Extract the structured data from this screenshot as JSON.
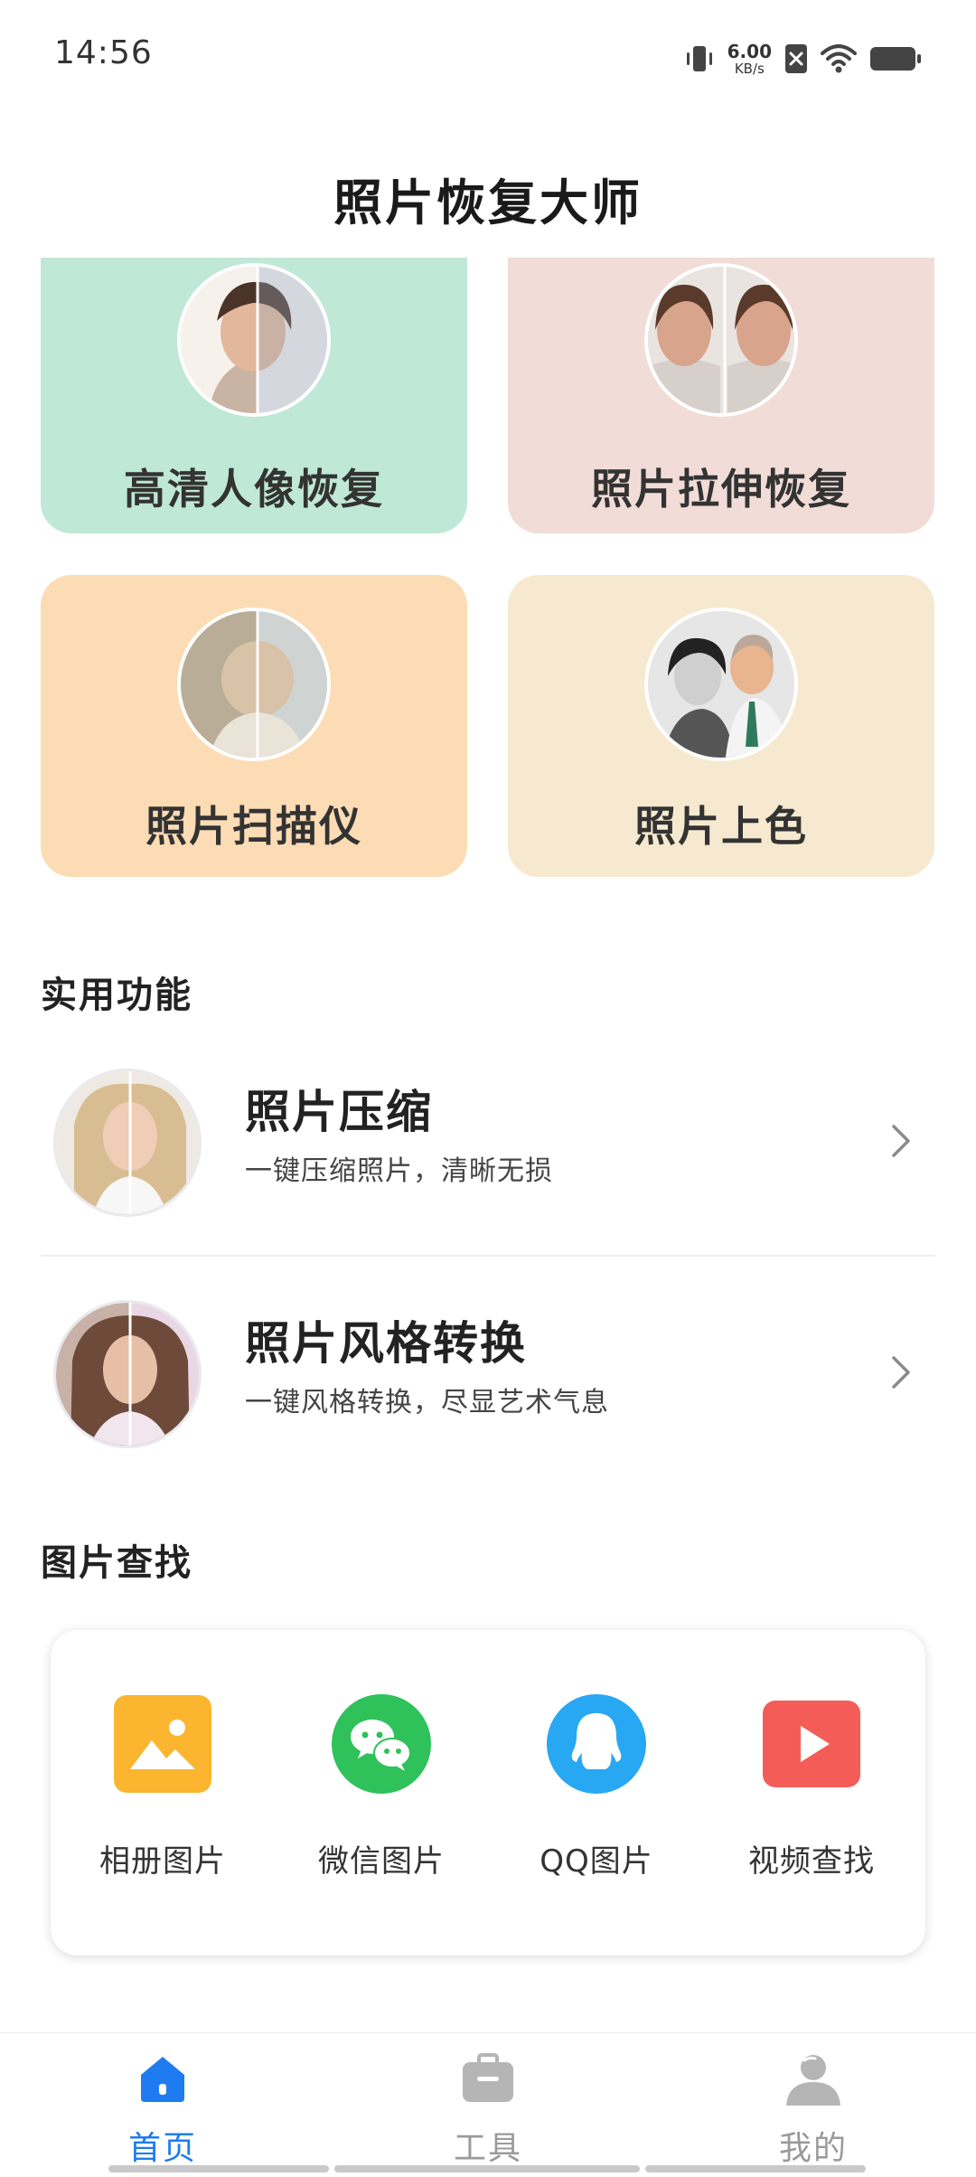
{
  "status_bar": {
    "time": "14:56",
    "net_speed_value": "6.00",
    "net_speed_unit": "KB/s",
    "icons": [
      "vibrate-icon",
      "net-speed",
      "sim-disabled-icon",
      "wifi-icon",
      "battery-icon"
    ]
  },
  "header": {
    "title": "照片恢复大师"
  },
  "feature_cards": [
    {
      "label": "高清人像恢复",
      "bg": "#bfe8d7"
    },
    {
      "label": "照片拉伸恢复",
      "bg": "#f1dcd7"
    },
    {
      "label": "照片扫描仪",
      "bg": "#fcdcb5"
    },
    {
      "label": "照片上色",
      "bg": "#f6e9cf"
    }
  ],
  "practical": {
    "heading": "实用功能",
    "items": [
      {
        "title": "照片压缩",
        "subtitle": "一键压缩照片，清晰无损"
      },
      {
        "title": "照片风格转换",
        "subtitle": "一键风格转换，尽显艺术气息"
      }
    ]
  },
  "picture_search": {
    "heading": "图片查找",
    "items": [
      {
        "label": "相册图片",
        "icon": "album-icon",
        "color": "#fbb52f"
      },
      {
        "label": "微信图片",
        "icon": "wechat-icon",
        "color": "#2fc15a"
      },
      {
        "label": "QQ图片",
        "icon": "qq-icon",
        "color": "#28a7f2"
      },
      {
        "label": "视频查找",
        "icon": "video-icon",
        "color": "#f45c57"
      }
    ]
  },
  "bottom_nav": {
    "items": [
      {
        "label": "首页",
        "icon": "home-icon",
        "active": true
      },
      {
        "label": "工具",
        "icon": "toolbox-icon",
        "active": false
      },
      {
        "label": "我的",
        "icon": "profile-icon",
        "active": false
      }
    ],
    "active_color": "#1e7cf0",
    "inactive_color": "#9a9a9a"
  }
}
